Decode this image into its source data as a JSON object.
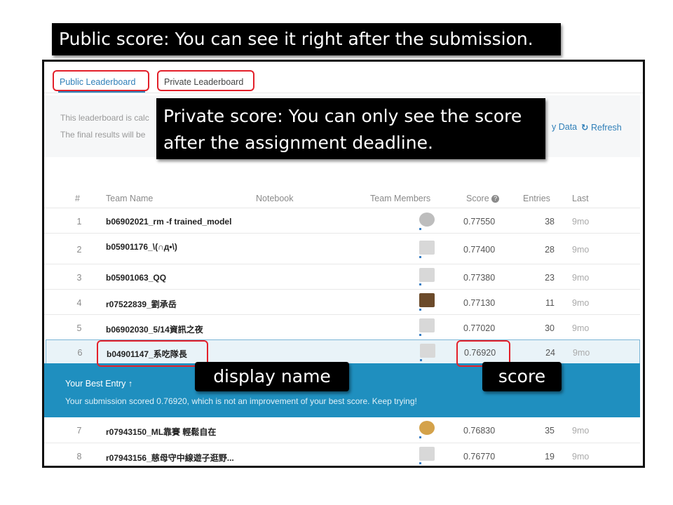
{
  "callouts": {
    "public": "Public score: You can see it right after the submission.",
    "private_line1": "Private score: You can only see the score",
    "private_line2": "after the assignment deadline.",
    "display_name": "display name",
    "score": "score"
  },
  "tabs": {
    "public": "Public Leaderboard",
    "private": "Private Leaderboard"
  },
  "info": {
    "line1": "This leaderboard is calc",
    "line2": "The final results will be",
    "data_link": "y Data",
    "refresh_icon": "refresh-icon",
    "refresh_label": "Refresh"
  },
  "table": {
    "headers": {
      "rank": "#",
      "team": "Team Name",
      "notebook": "Notebook",
      "members": "Team Members",
      "score": "Score",
      "entries": "Entries",
      "last": "Last"
    },
    "rows": [
      {
        "rank": "1",
        "team": "b06902021_rm -f trained_model",
        "score": "0.77550",
        "entries": "38",
        "last": "9mo",
        "avatar_color": "#bdbdbd"
      },
      {
        "rank": "2",
        "team": "b05901176_\\(∩д•\\)",
        "score": "0.77400",
        "entries": "28",
        "last": "9mo",
        "avatar_color": "#d8d8d8"
      },
      {
        "rank": "3",
        "team": "b05901063_QQ",
        "score": "0.77380",
        "entries": "23",
        "last": "9mo",
        "avatar_color": "#d8d8d8"
      },
      {
        "rank": "4",
        "team": "r07522839_劉承岳",
        "score": "0.77130",
        "entries": "11",
        "last": "9mo",
        "avatar_color": "#6b4a2a"
      },
      {
        "rank": "5",
        "team": "b06902030_5/14資訊之夜",
        "score": "0.77020",
        "entries": "30",
        "last": "9mo",
        "avatar_color": "#d8d8d8"
      },
      {
        "rank": "6",
        "team": "b04901147_系吃隊長",
        "score": "0.76920",
        "entries": "24",
        "last": "9mo",
        "avatar_color": "#d8d8d8"
      },
      {
        "rank": "7",
        "team": "r07943150_ML靠賽 輕鬆自在",
        "score": "0.76830",
        "entries": "35",
        "last": "9mo",
        "avatar_color": "#d4a24a"
      },
      {
        "rank": "8",
        "team": "r07943156_慈母守中線遊子逛野...",
        "score": "0.76770",
        "entries": "19",
        "last": "9mo",
        "avatar_color": "#d8d8d8"
      }
    ]
  },
  "best_entry": {
    "title": "Your Best Entry",
    "arrow_icon": "arrow-up-icon",
    "text": "Your submission scored 0.76920, which is not an improvement of your best score. Keep trying!"
  }
}
